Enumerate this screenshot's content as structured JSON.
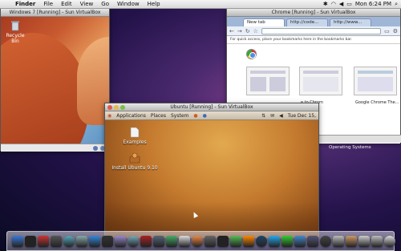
{
  "menubar": {
    "apple_glyph": "",
    "items": [
      "Finder",
      "File",
      "Edit",
      "View",
      "Go",
      "Window",
      "Help"
    ],
    "clock": "Mon 6:24 PM",
    "icons": [
      "bluetooth-icon",
      "wifi-icon",
      "volume-icon",
      "battery-icon",
      "spotlight-icon"
    ]
  },
  "desktop": {
    "recycle_bin_label": "Recycle Bin"
  },
  "win7_window": {
    "title": "Windows 7 [Running] - Sun VirtualBox"
  },
  "chrome_window": {
    "title": "Chrome [Running] - Sun VirtualBox",
    "tabs": [
      "New tab",
      "http://code...",
      "http://www..."
    ],
    "bookmarks_hint": "For quick access, place your bookmarks here in the bookmarks bar.",
    "thumb_captions": [
      "e to Chrom",
      "Google Chrome The..."
    ],
    "os_label": "Operating Systems"
  },
  "ubuntu_window": {
    "title": "Ubuntu [Running] - Sun VirtualBox",
    "panel_menus": [
      "Applications",
      "Places",
      "System"
    ],
    "clock": "Tue Dec 15,",
    "desktop_icons": [
      "Examples",
      "Install Ubuntu 9.10"
    ]
  },
  "colors": {
    "mac_wallpaper": "#4a2a6e",
    "ubuntu_wallpaper": "#c47a2e",
    "chrome_frame": "#9fb6d6"
  },
  "dock_icons": [
    {
      "name": "finder-icon",
      "color": "#3a78d8"
    },
    {
      "name": "dashboard-icon",
      "color": "#222"
    },
    {
      "name": "activity-icon",
      "color": "#c33"
    },
    {
      "name": "clock-icon",
      "color": "#555"
    },
    {
      "name": "safari-icon",
      "color": "#5ab"
    },
    {
      "name": "mail-icon",
      "color": "#8aa"
    },
    {
      "name": "ichat-icon",
      "color": "#38d"
    },
    {
      "name": "lightroom-icon",
      "color": "#333"
    },
    {
      "name": "preview-icon",
      "color": "#98c"
    },
    {
      "name": "itunes-icon",
      "color": "#7ab"
    },
    {
      "name": "photobooth-icon",
      "color": "#a22"
    },
    {
      "name": "spaces-icon",
      "color": "#567"
    },
    {
      "name": "timemachine-icon",
      "color": "#4a6"
    },
    {
      "name": "ical-icon",
      "color": "#ddd"
    },
    {
      "name": "firefox-icon",
      "color": "#e84"
    },
    {
      "name": "gimp-icon",
      "color": "#666"
    },
    {
      "name": "terminal-icon",
      "color": "#222"
    },
    {
      "name": "evernote-icon",
      "color": "#5b5"
    },
    {
      "name": "vlc-icon",
      "color": "#f80"
    },
    {
      "name": "photoshop-icon",
      "color": "#246"
    },
    {
      "name": "skype-icon",
      "color": "#2ae"
    },
    {
      "name": "chat-icon",
      "color": "#3c3"
    },
    {
      "name": "network-icon",
      "color": "#48c"
    },
    {
      "name": "virtualbox-icon",
      "color": "#557"
    },
    {
      "name": "growl-icon",
      "color": "#444"
    },
    {
      "name": "inspector-icon",
      "color": "#bbb"
    },
    {
      "name": "photos-icon",
      "color": "#c96"
    },
    {
      "name": "downloads-icon",
      "color": "#ccc"
    },
    {
      "name": "documents-icon",
      "color": "#bbb"
    },
    {
      "name": "trash-icon",
      "color": "#ddd"
    }
  ]
}
